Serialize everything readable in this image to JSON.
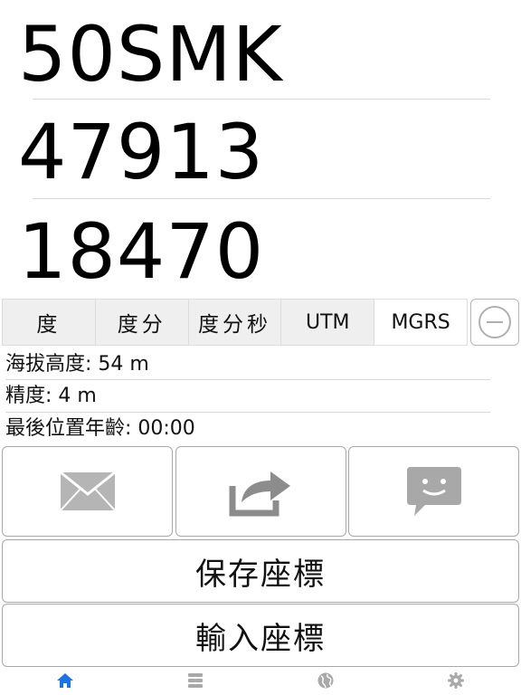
{
  "coordinates": {
    "grid_zone": "50SMK",
    "easting": "47913",
    "northing": "18470"
  },
  "format_selector": {
    "options": [
      "度",
      "度分",
      "度分秒",
      "UTM",
      "MGRS"
    ],
    "selected": "MGRS"
  },
  "info": {
    "altitude": "海拔高度: 54 m",
    "accuracy": "精度: 4 m",
    "last_fix_age": "最後位置年齡: 00:00"
  },
  "actions": {
    "save_label": "保存座標",
    "input_label": "輸入座標"
  },
  "icons": {
    "share": [
      "mail-icon",
      "share-arrow-icon",
      "message-bubble-icon"
    ],
    "tabs": [
      "home-icon",
      "list-icon",
      "globe-icon",
      "gear-icon"
    ]
  },
  "colors": {
    "tab_active": "#1a73e8",
    "tab_inactive": "#a9a9a9",
    "icon_gray": "#a6a6a6"
  }
}
